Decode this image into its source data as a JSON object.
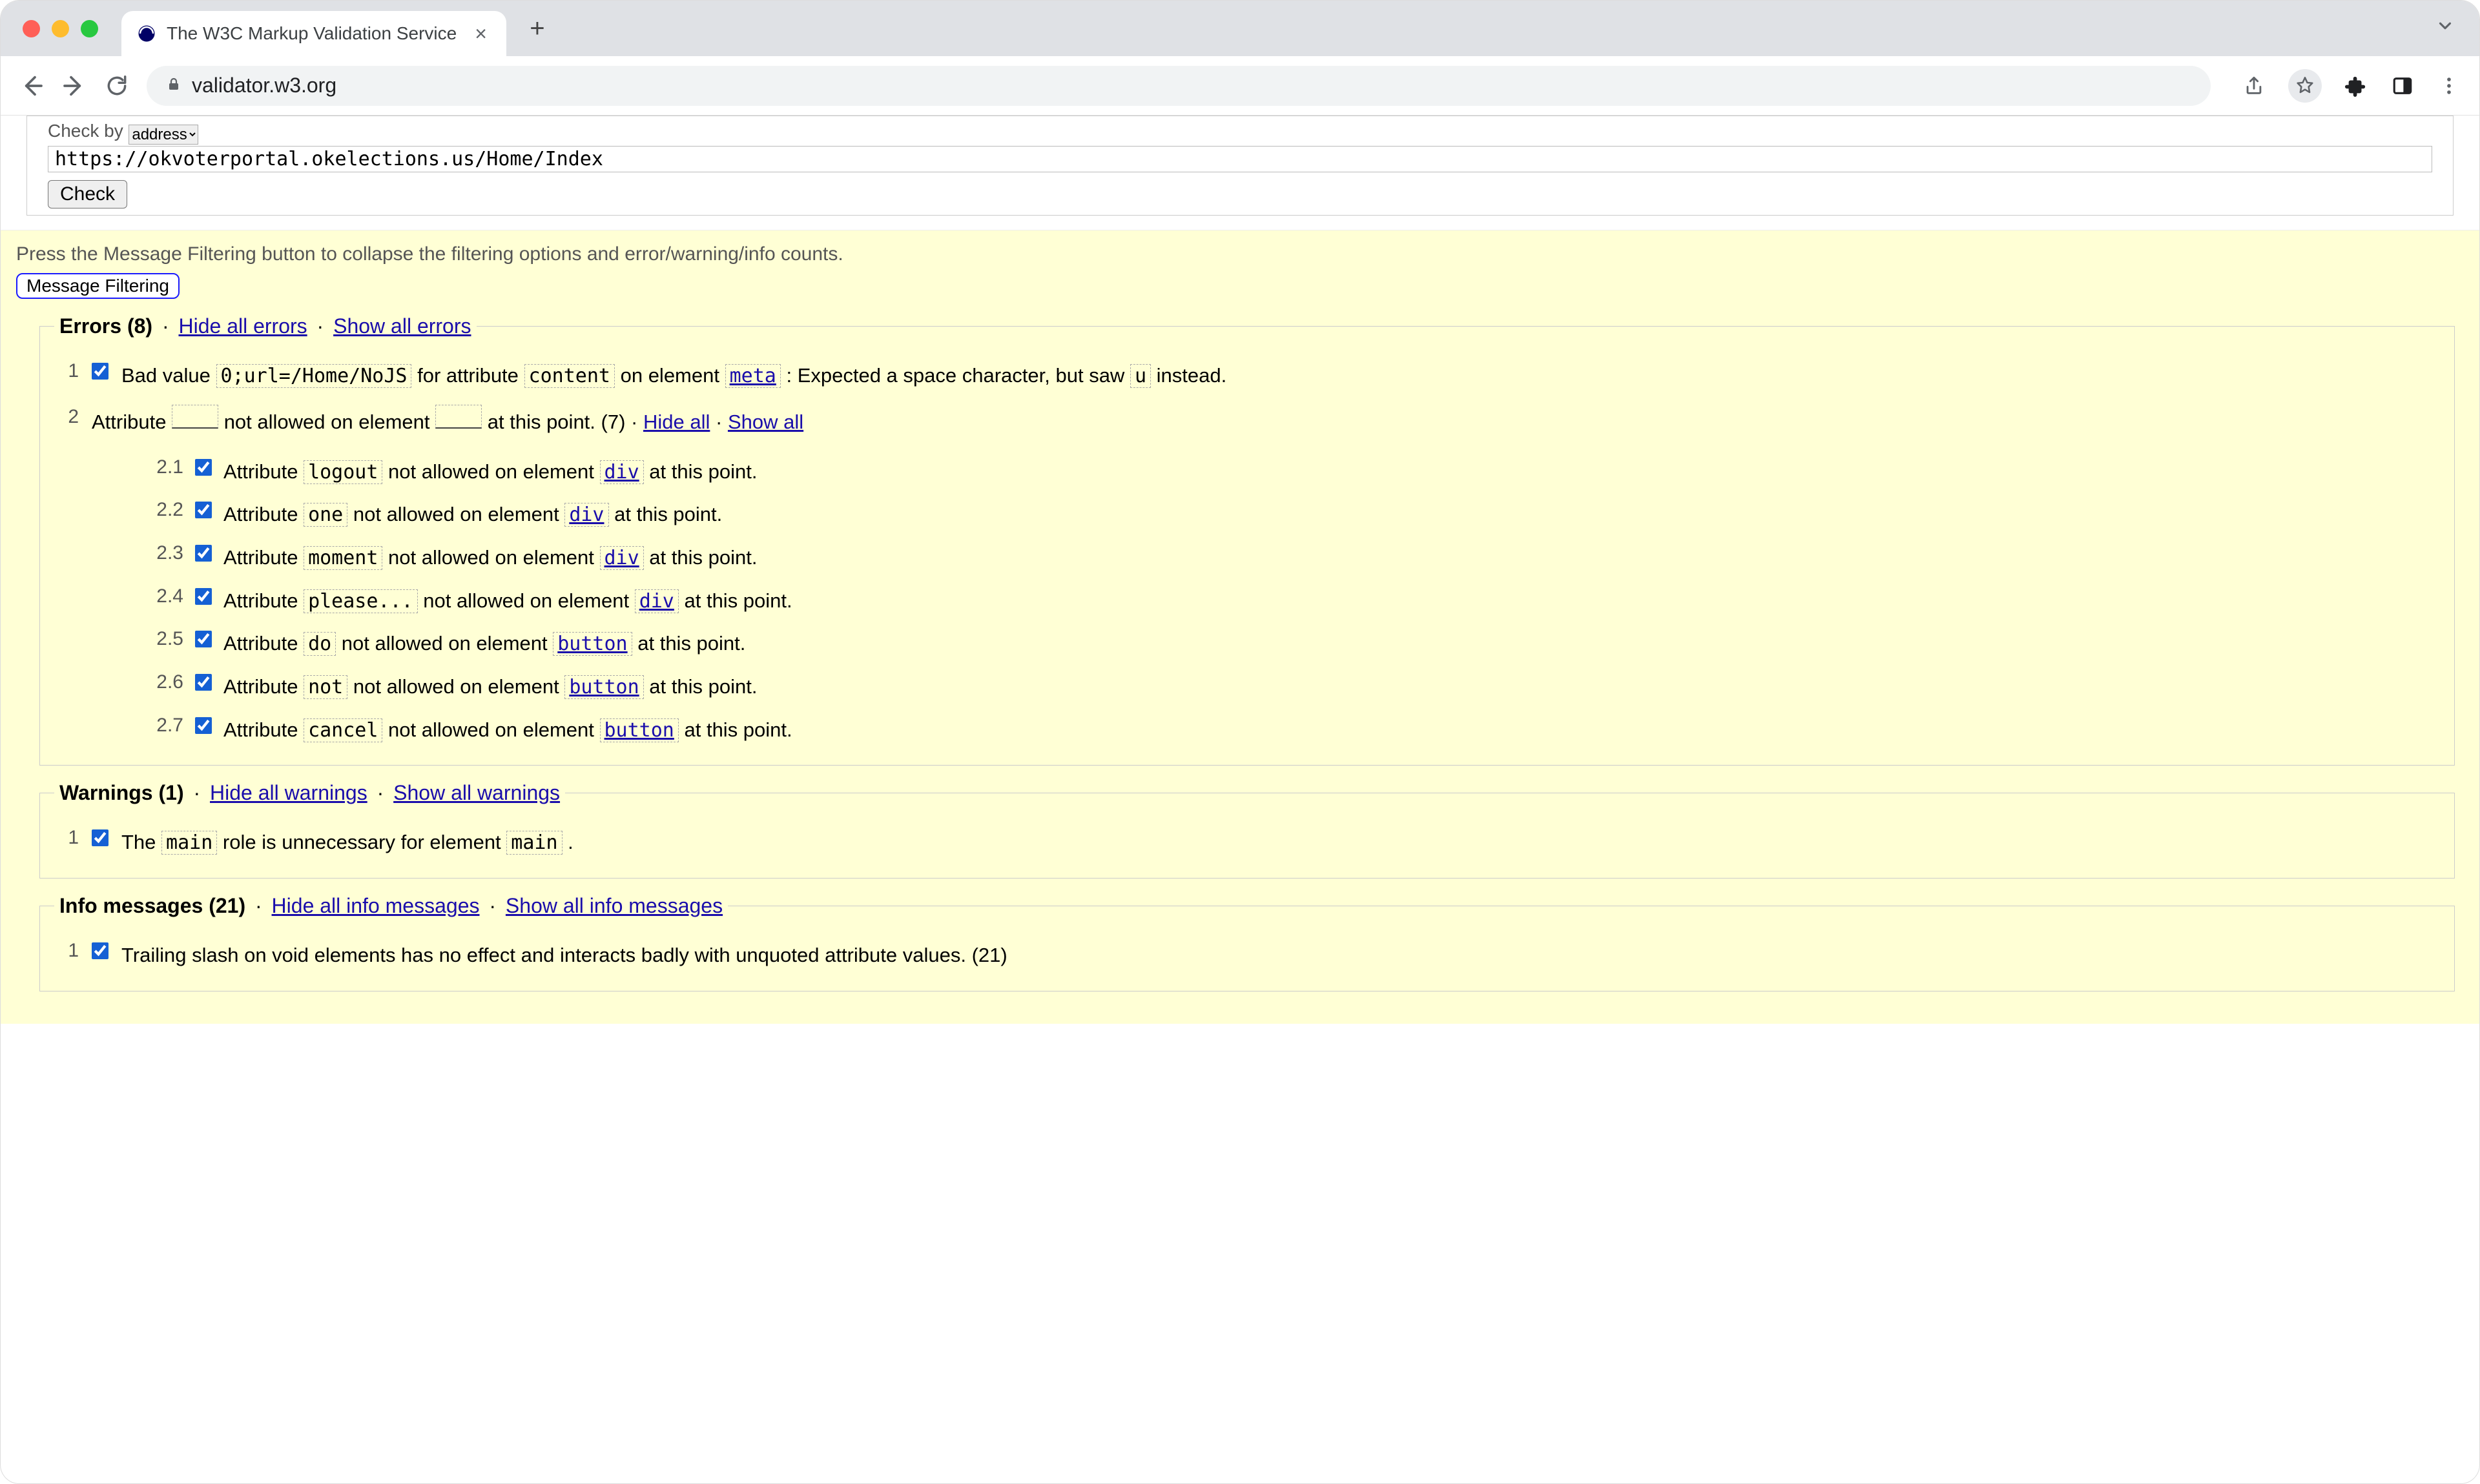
{
  "browser": {
    "tab_title": "The W3C Markup Validation Service",
    "url": "validator.w3.org",
    "back_tip": "Back",
    "forward_tip": "Forward",
    "reload_tip": "Reload",
    "share_tip": "Share",
    "star_tip": "Bookmark",
    "ext_tip": "Extensions",
    "menu_tip": "Menu"
  },
  "checker": {
    "trunc_label": "Check by",
    "select_value": "address",
    "address_value": "https://okvoterportal.okelections.us/Home/Index",
    "check_button": "Check"
  },
  "filter_hint": "Press the Message Filtering button to collapse the filtering options and error/warning/info counts.",
  "message_filtering_button": "Message Filtering",
  "errors": {
    "legend_label": "Errors",
    "count": "8",
    "hide_link": "Hide all errors",
    "show_link": "Show all errors",
    "item1_num": "1",
    "item1_pre": " Bad value ",
    "item1_badval": "0;url=/Home/NoJS",
    "item1_mid1": " for attribute ",
    "item1_attr": "content",
    "item1_mid2": " on element ",
    "item1_elem": "meta",
    "item1_mid3": ": Expected a space character, but saw ",
    "item1_char": "u",
    "item1_end": " instead.",
    "item2_num": "2",
    "item2_pre": " Attribute ",
    "item2_mid": " not allowed on element ",
    "item2_post": " at this point. ",
    "item2_count": "(7)",
    "item2_hide": "Hide all",
    "item2_show": "Show all",
    "subs": [
      {
        "num": "2.1",
        "attr": "logout",
        "elem": "div"
      },
      {
        "num": "2.2",
        "attr": "one",
        "elem": "div"
      },
      {
        "num": "2.3",
        "attr": "moment",
        "elem": "div"
      },
      {
        "num": "2.4",
        "attr": "please...",
        "elem": "div"
      },
      {
        "num": "2.5",
        "attr": "do",
        "elem": "button"
      },
      {
        "num": "2.6",
        "attr": "not",
        "elem": "button"
      },
      {
        "num": "2.7",
        "attr": "cancel",
        "elem": "button"
      }
    ],
    "sub_pre": "Attribute ",
    "sub_mid": " not allowed on element ",
    "sub_post": " at this point."
  },
  "warnings": {
    "legend_label": "Warnings",
    "count": "1",
    "hide_link": "Hide all warnings",
    "show_link": "Show all warnings",
    "item1_num": "1",
    "item1_pre": " The ",
    "item1_code1": "main",
    "item1_mid": " role is unnecessary for element ",
    "item1_code2": "main",
    "item1_end": "."
  },
  "info": {
    "legend_label": "Info messages",
    "count": "21",
    "hide_link": "Hide all info messages",
    "show_link": "Show all info messages",
    "item1_num": "1",
    "item1_text": " Trailing slash on void elements has no effect and interacts badly with unquoted attribute values. ",
    "item1_count": "(21)"
  },
  "sep_dot": " · "
}
